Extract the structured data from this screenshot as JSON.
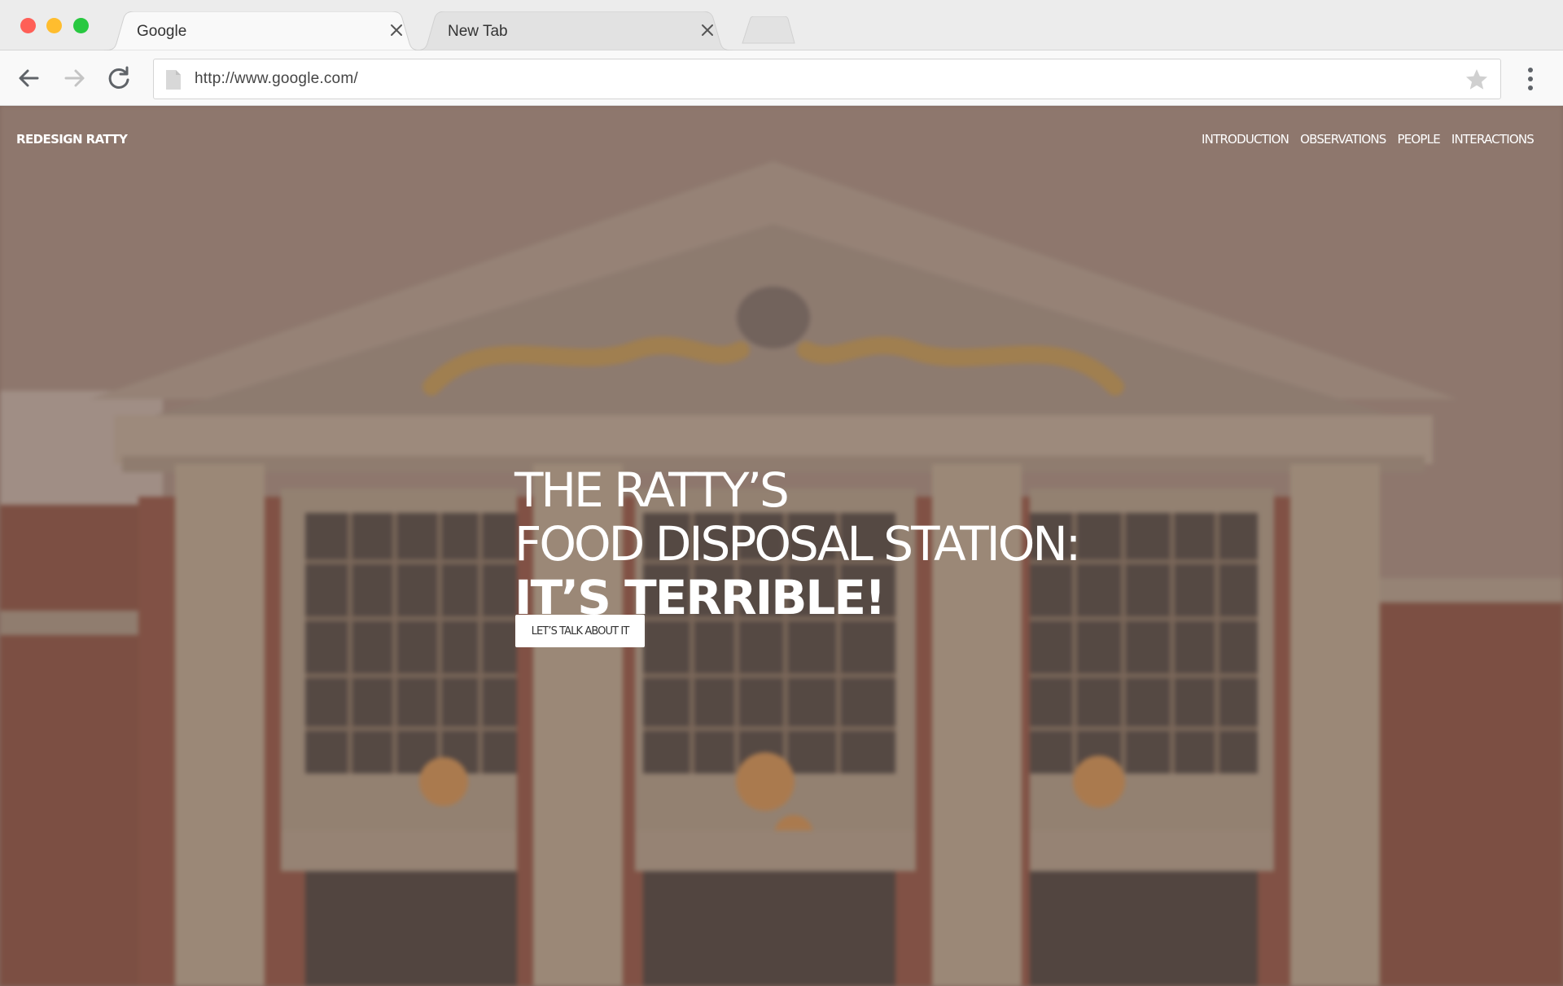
{
  "browser": {
    "window_controls": {
      "close_color": "#ff5f57",
      "minimize_color": "#ffbd2e",
      "maximize_color": "#28c840"
    },
    "tabs": [
      {
        "label": "Google",
        "active": true
      },
      {
        "label": "New Tab",
        "active": false
      }
    ],
    "toolbar": {
      "back_icon": "arrow-left-icon",
      "forward_icon": "arrow-right-icon",
      "reload_icon": "reload-icon",
      "url": "http://www.google.com/",
      "bookmark_icon": "star-icon",
      "menu_icon": "kebab-menu-icon"
    }
  },
  "site": {
    "brand": "REDESIGN RATTY",
    "nav": [
      {
        "label": "INTRODUCTION"
      },
      {
        "label": "OBSERVATIONS"
      },
      {
        "label": "PEOPLE"
      },
      {
        "label": "INTERACTIONS"
      }
    ],
    "hero": {
      "headline_line_1": "THE RATTY’S",
      "headline_line_2": "FOOD DISPOSAL STATION:",
      "headline_line_3": "IT’S TERRIBLE!",
      "cta_label": "LET’S TALK ABOUT IT"
    }
  },
  "colors": {
    "hero_tint": "#8a6f66",
    "brick": "#8f4b3c",
    "pediment": "#a89680",
    "column": "#b0a18c",
    "ornament": "#b8914c",
    "text_on_hero": "#ffffff"
  }
}
